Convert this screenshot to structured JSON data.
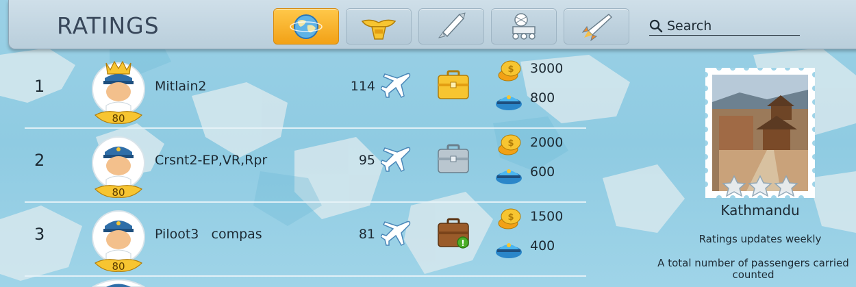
{
  "header": {
    "title": "RATINGS",
    "tabs": [
      {
        "icon": "globe-icon",
        "active": true
      },
      {
        "icon": "wings-badge-icon",
        "active": false
      },
      {
        "icon": "rocket-icon",
        "active": false
      },
      {
        "icon": "lunar-rover-icon",
        "active": false
      },
      {
        "icon": "space-shuttle-icon",
        "active": false
      }
    ],
    "search_placeholder": "Search"
  },
  "rows": [
    {
      "rank": "1",
      "name": "Mitlain2",
      "level": "80",
      "flights": "114",
      "case": "gold",
      "coins": "3000",
      "caps": "800"
    },
    {
      "rank": "2",
      "name": "Crsnt2-EP,VR,Rpr",
      "level": "80",
      "flights": "95",
      "case": "silver",
      "coins": "2000",
      "caps": "600"
    },
    {
      "rank": "3",
      "name": "Piloot3   compas",
      "level": "80",
      "flights": "81",
      "case": "bronze",
      "coins": "1500",
      "caps": "400"
    }
  ],
  "panel": {
    "city": "Kathmandu",
    "note1": "Ratings updates weekly",
    "note2": "A total number of passengers carried counted",
    "stars": 3
  },
  "colors": {
    "accent": "#f5a81c",
    "header_bg": "#c3d6e2",
    "map_water": "#93cde3",
    "map_land": "#d8e8ee"
  }
}
